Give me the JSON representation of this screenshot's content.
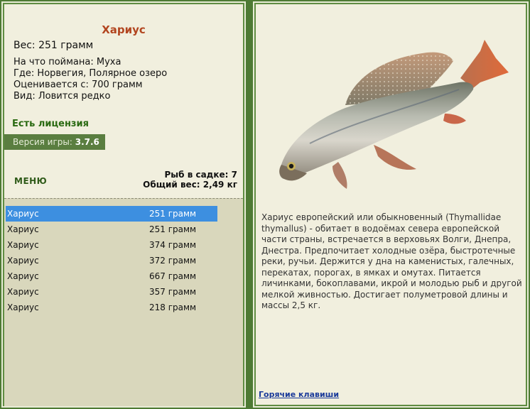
{
  "fish": {
    "title": "Хариус",
    "weight_line": "Вес: 251 грамм",
    "caught_on": "На что поймана: Муха",
    "where": "Где: Норвегия, Полярное озеро",
    "value": "Оценивается с: 700 грамм",
    "kind": "Вид: Ловится редко"
  },
  "license": "Есть лицензия",
  "version": {
    "label": "Версия игры: ",
    "number": "3.7.6"
  },
  "menu_label": "МЕНЮ",
  "summary": {
    "fish_in_keepnet": "Рыб в садке: 7",
    "total_weight": "Общий вес: 2,49 кг"
  },
  "catch_list": [
    {
      "name": "Хариус",
      "weight": "251 грамм",
      "selected": true
    },
    {
      "name": "Хариус",
      "weight": "251 грамм"
    },
    {
      "name": "Хариус",
      "weight": "374 грамм"
    },
    {
      "name": "Хариус",
      "weight": "372 грамм"
    },
    {
      "name": "Хариус",
      "weight": "667 грамм"
    },
    {
      "name": "Хариус",
      "weight": "357 грамм"
    },
    {
      "name": "Хариус",
      "weight": "218 грамм"
    }
  ],
  "description": "Хариус европейский или обыкновенный (Thymallidae thymallus) - обитает в водоёмах севера европейской части страны, встречается в верховьях Волги, Днепра, Днестра. Предпочитает холодные озёра, быстротечные реки, ручьи. Держится у дна на каменистых, галечных, перекатах, порогах, в ямках и омутах. Питается личинками, бокоплавами, икрой и молодью рыб и другой мелкой живностью. Достигает полуметровой длины и массы 2,5 кг.",
  "hotkeys_link": "Горячие клавиши",
  "colors": {
    "selection": "#3d8fe0",
    "frame": "#4e7a34",
    "title": "#b2451f",
    "license": "#2a6a12"
  }
}
